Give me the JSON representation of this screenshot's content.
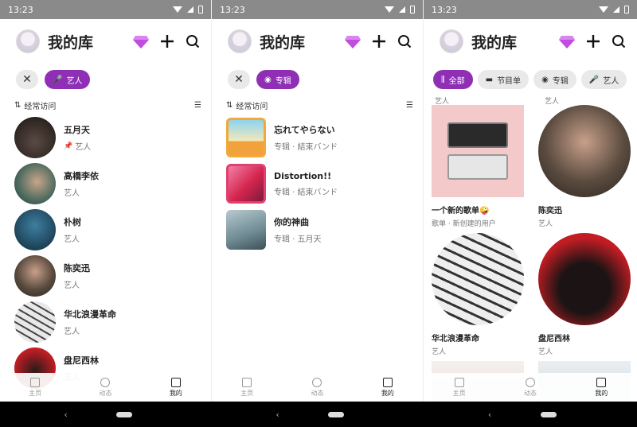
{
  "status": {
    "time": "13:23"
  },
  "header": {
    "title": "我的库"
  },
  "colors": {
    "accent": "#8e2fb5",
    "gem": "#c24be0"
  },
  "panel1": {
    "chips": [
      {
        "label": "艺人",
        "icon": "mic-icon"
      }
    ],
    "sort_label": "经常访问",
    "items": [
      {
        "name": "五月天",
        "sub": "艺人",
        "pinned": true
      },
      {
        "name": "高橋李依",
        "sub": "艺人"
      },
      {
        "name": "朴树",
        "sub": "艺人"
      },
      {
        "name": "陈奕迅",
        "sub": "艺人"
      },
      {
        "name": "华北浪漫革命",
        "sub": "艺人"
      },
      {
        "name": "盘尼西林",
        "sub": "艺人"
      }
    ]
  },
  "panel2": {
    "chips": [
      {
        "label": "专辑",
        "icon": "disc-icon"
      }
    ],
    "sort_label": "经常访问",
    "items": [
      {
        "name": "忘れてやらない",
        "sub": "专辑 · 結束バンド"
      },
      {
        "name": "Distortion!!",
        "sub": "专辑 · 結束バンド"
      },
      {
        "name": "你的神曲",
        "sub": "专辑 · 五月天"
      }
    ]
  },
  "panel3": {
    "chips": [
      {
        "label": "全部",
        "icon": "waveform-icon"
      },
      {
        "label": "节目单",
        "icon": "folder-icon"
      },
      {
        "label": "专辑",
        "icon": "disc-icon"
      },
      {
        "label": "艺人",
        "icon": "mic-icon"
      }
    ],
    "top_cut": [
      "艺人",
      "艺人"
    ],
    "cells": [
      {
        "name": "一个新的歌单🤪",
        "sub": "歌单 · 新创建的用户"
      },
      {
        "name": "陈奕迅",
        "sub": "艺人"
      },
      {
        "name": "华北浪漫革命",
        "sub": "艺人"
      },
      {
        "name": "盘尼西林",
        "sub": "艺人"
      }
    ]
  },
  "tabs": [
    {
      "label": "主页",
      "icon": "music-note-icon"
    },
    {
      "label": "动态",
      "icon": "compass-icon"
    },
    {
      "label": "我的",
      "icon": "library-icon"
    }
  ]
}
